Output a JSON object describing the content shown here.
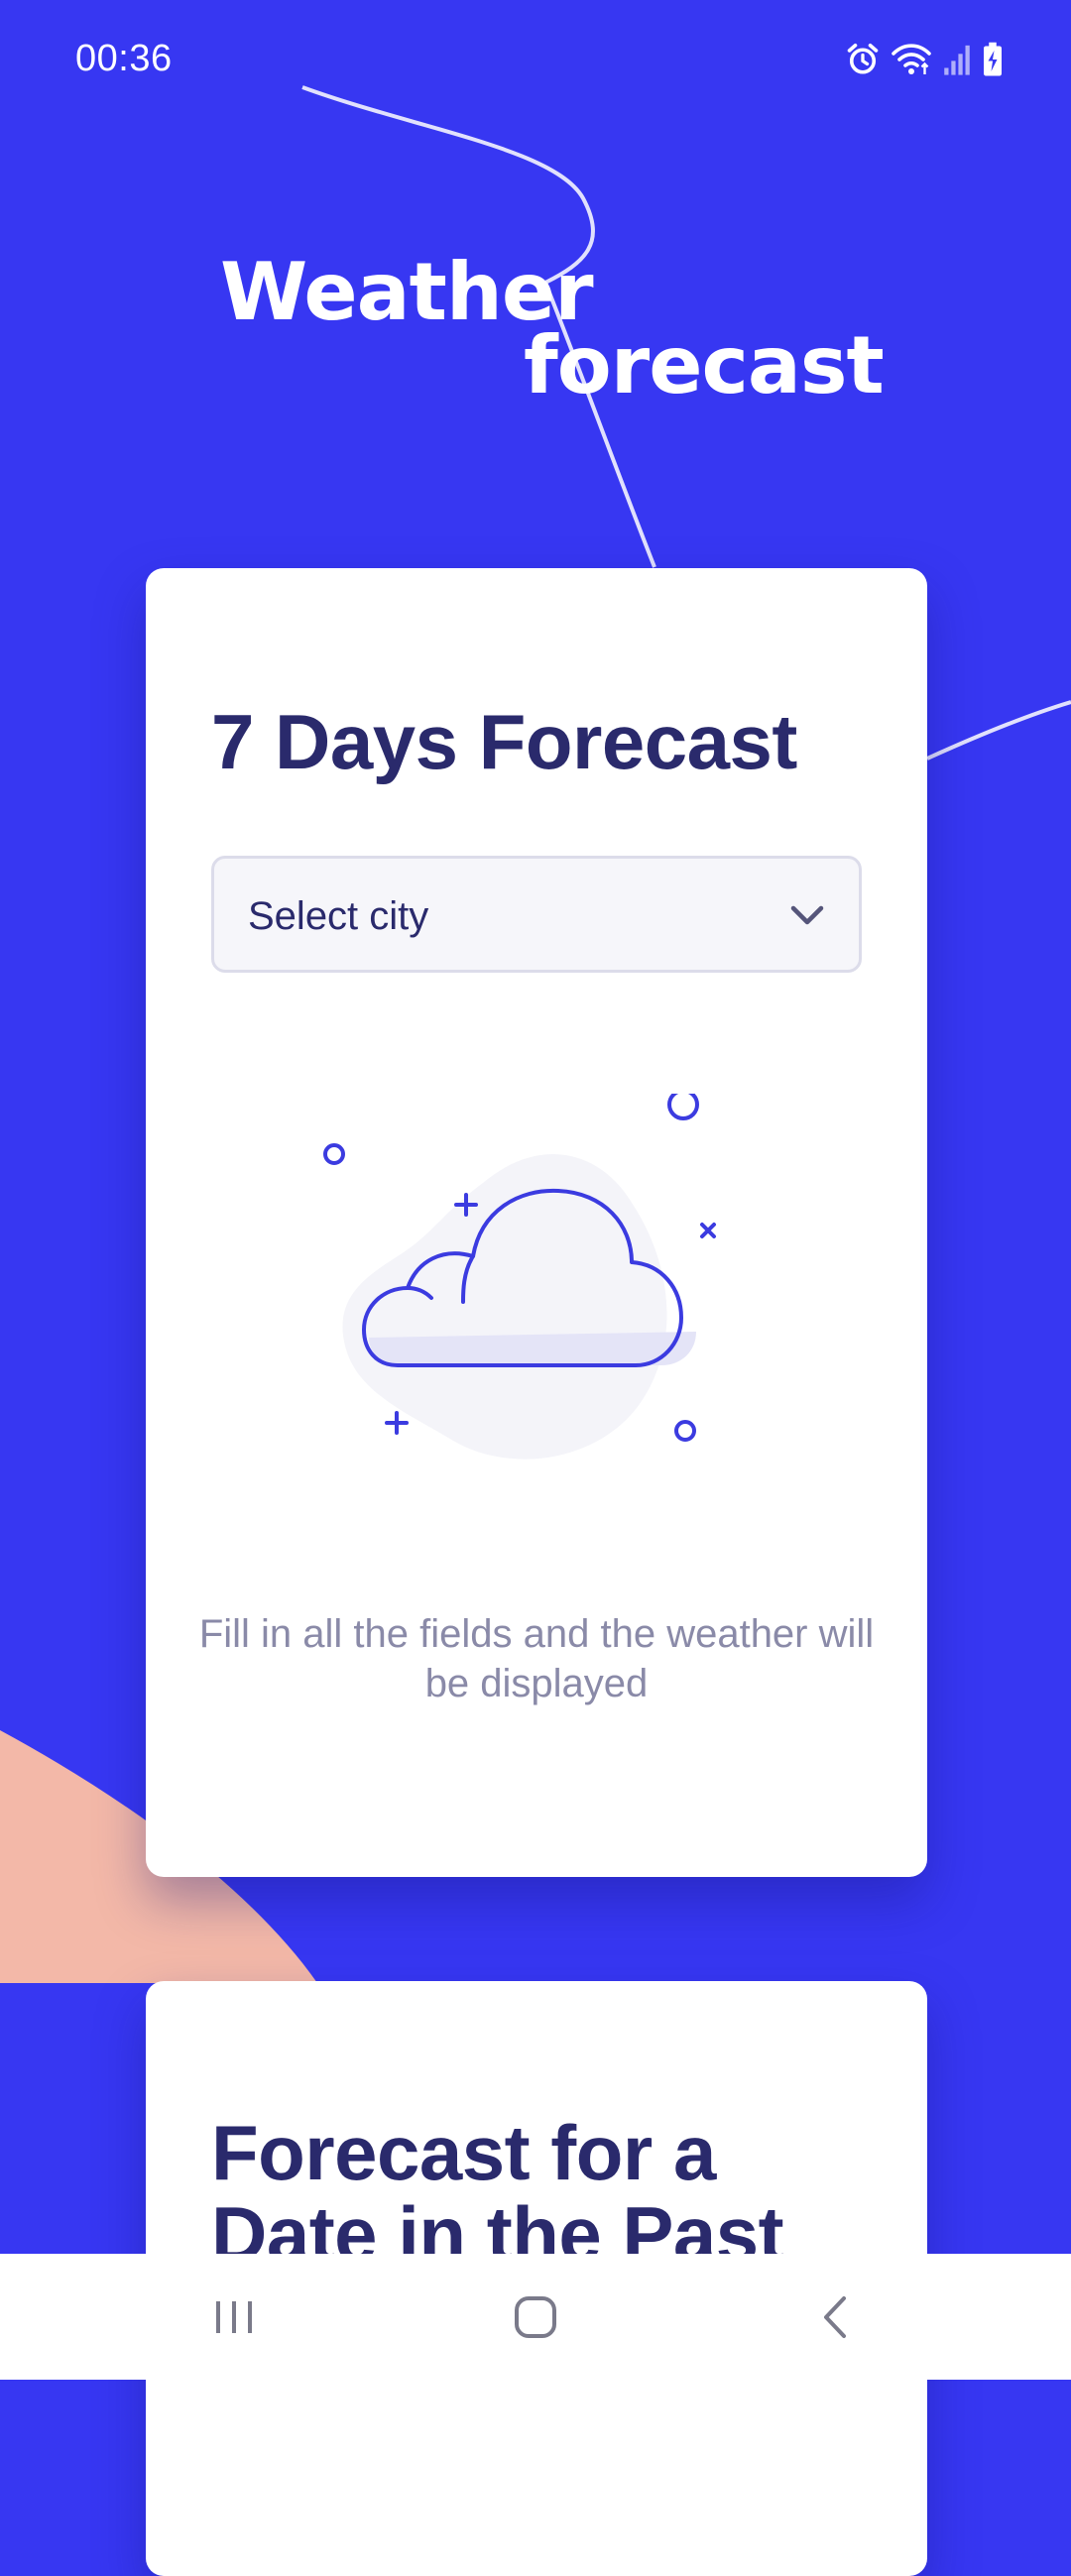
{
  "status_bar": {
    "time": "00:36",
    "icons": [
      "alarm-icon",
      "wifi-icon",
      "signal-icon",
      "battery-charging-icon"
    ]
  },
  "header": {
    "title_line1": "Weather",
    "title_line2": "forecast"
  },
  "forecast_card": {
    "title": "7 Days Forecast",
    "city_select": {
      "selected": "Select city"
    },
    "illustration": "cloud-icon",
    "hint": "Fill in all the fields and the weather will be displayed"
  },
  "past_card": {
    "title": "Forecast for a Date in the Past"
  },
  "colors": {
    "background": "#3737f2",
    "card": "#ffffff",
    "title_text": "#2a2a6c",
    "hint_text": "#8a8aa8",
    "accent": "#3b3be0",
    "peach_shape": "#f3b8a8"
  },
  "nav_bar": {
    "buttons": [
      "recents-icon",
      "home-icon",
      "back-icon"
    ]
  }
}
